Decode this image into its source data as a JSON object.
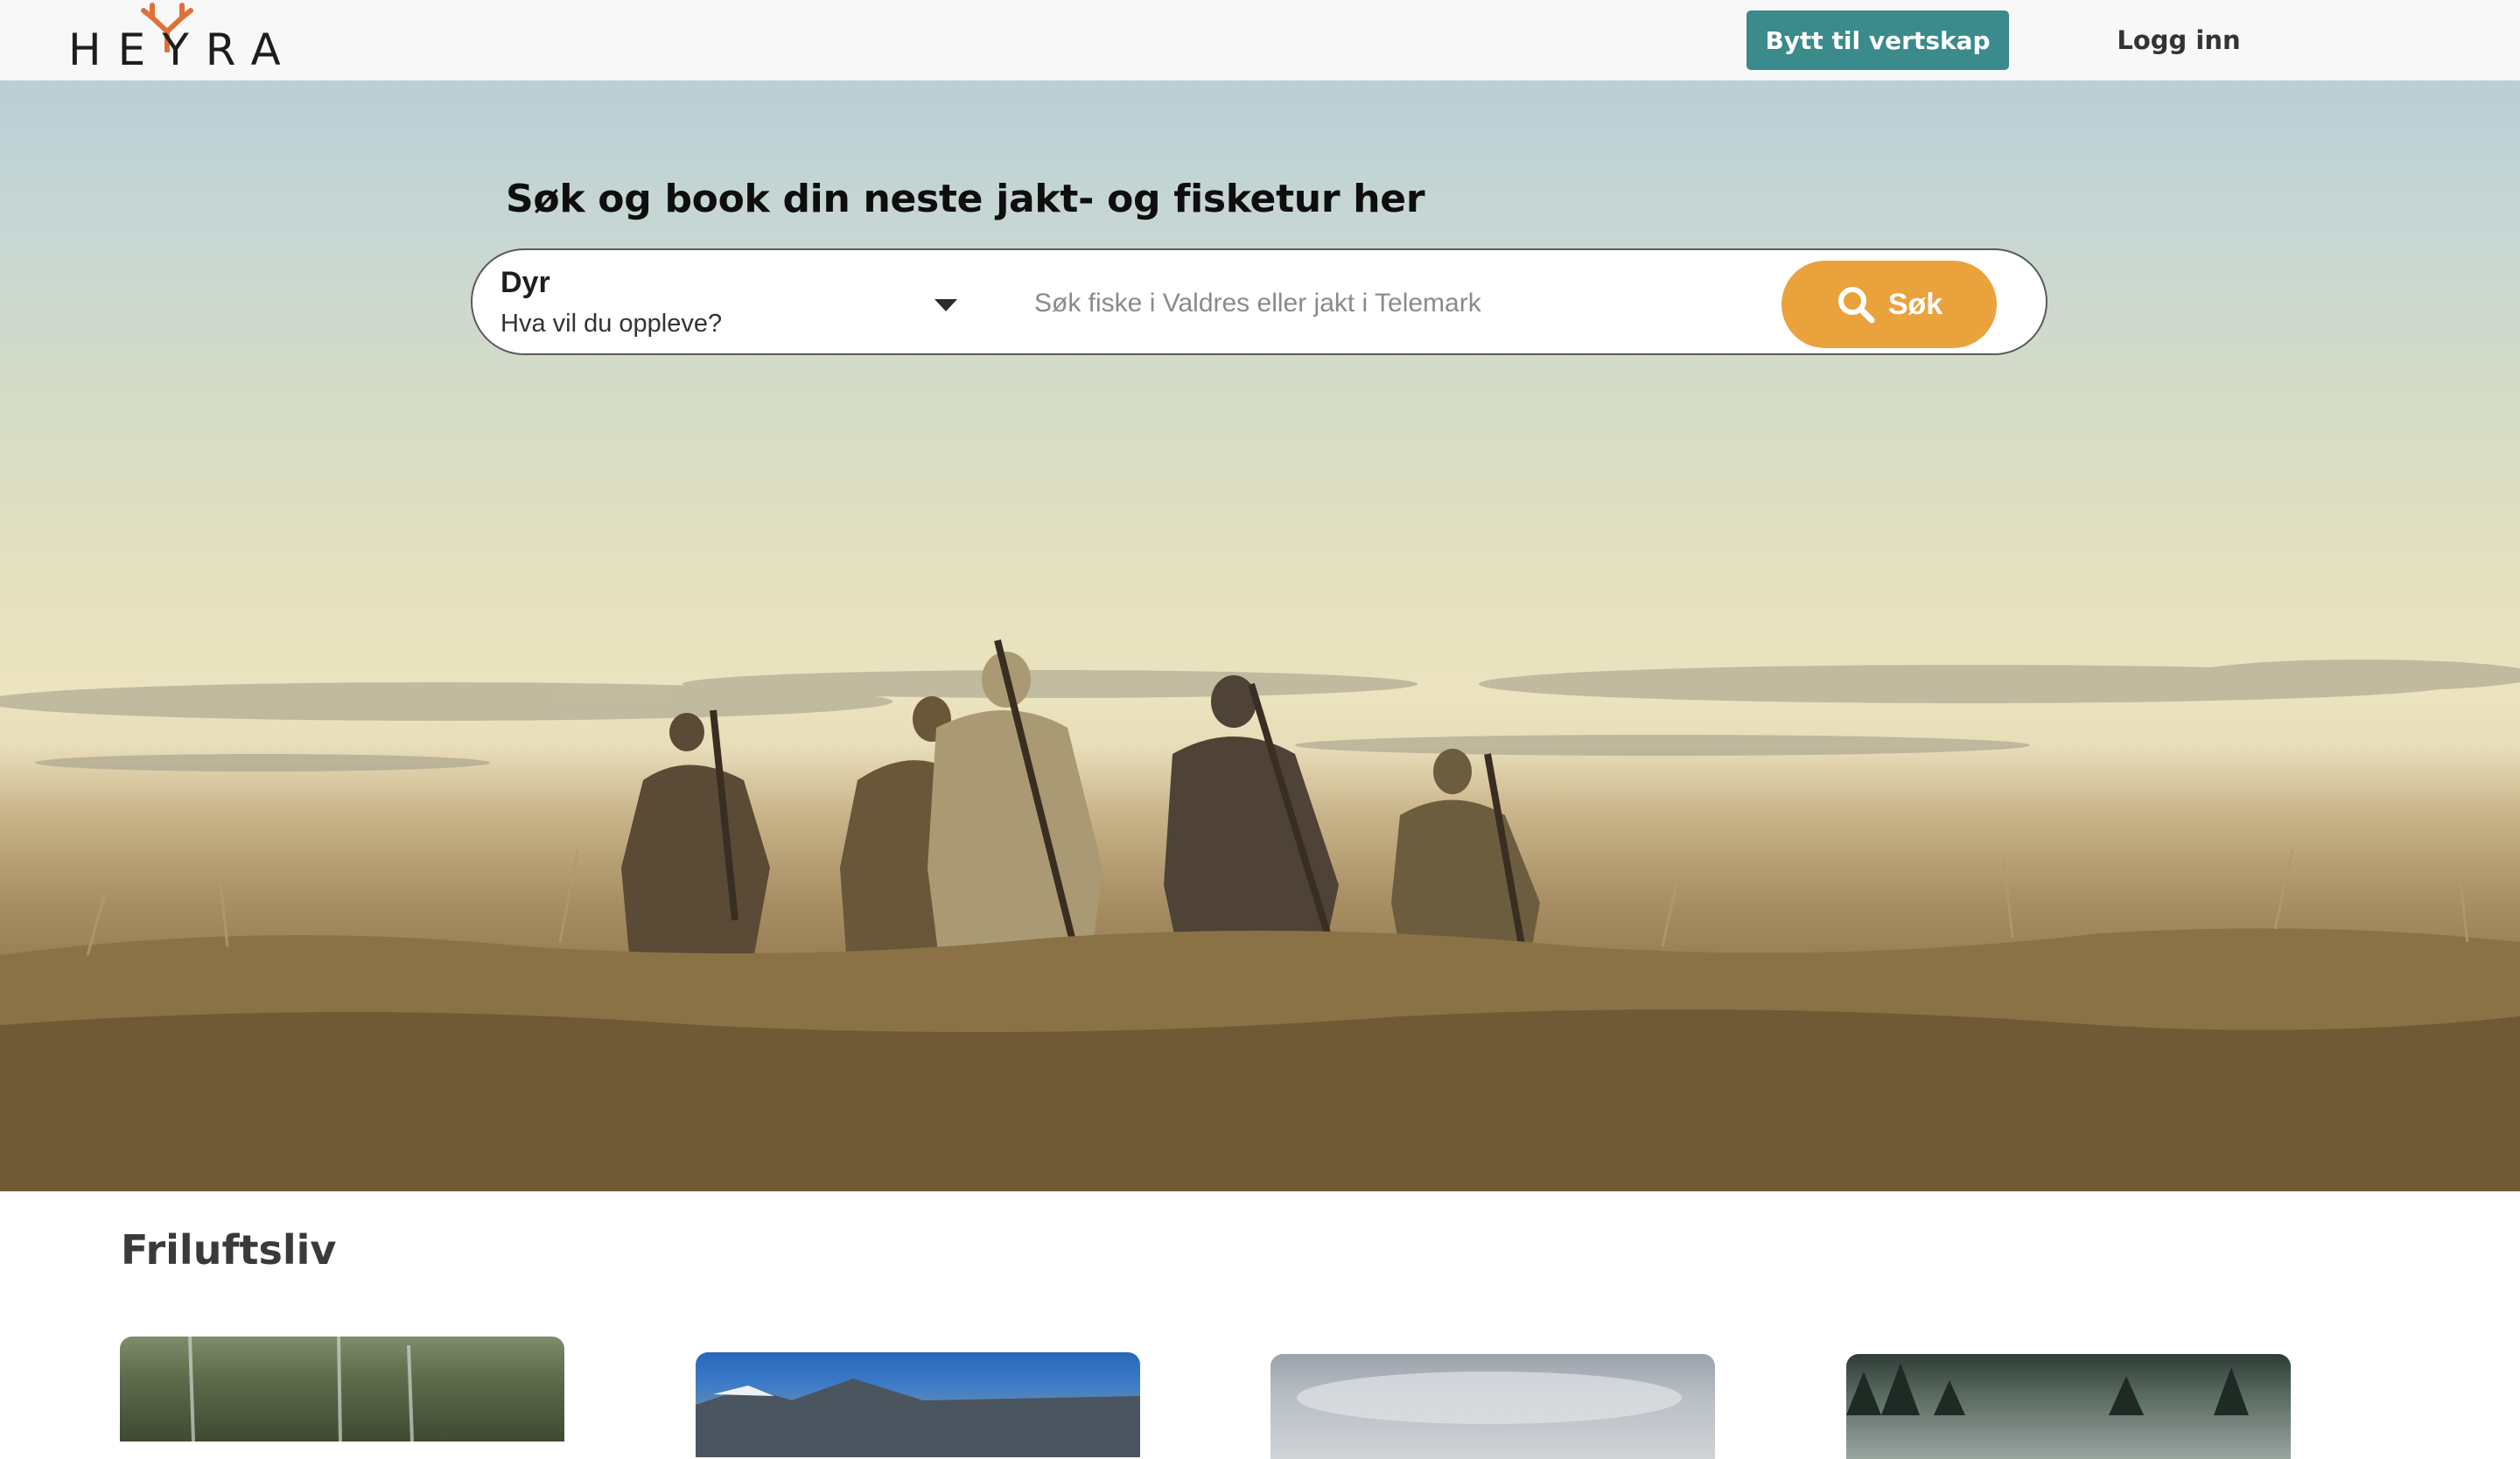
{
  "header": {
    "logo_text": "HEYRA",
    "switch_host_label": "Bytt til vertskap",
    "login_label": "Logg inn"
  },
  "hero": {
    "title": "Søk og book din neste jakt- og fisketur her",
    "category": {
      "label": "Dyr",
      "value": "Hva vil du oppleve?"
    },
    "search": {
      "placeholder": "Søk fiske i Valdres eller jakt i Telemark",
      "button_label": "Søk"
    }
  },
  "sections": {
    "outdoor_title": "Friluftsliv"
  },
  "colors": {
    "teal": "#3b8a8c",
    "orange": "#eaa23c",
    "antler": "#e0703a"
  },
  "icons": [
    "antler-logo-icon",
    "chevron-down-icon",
    "search-icon"
  ]
}
